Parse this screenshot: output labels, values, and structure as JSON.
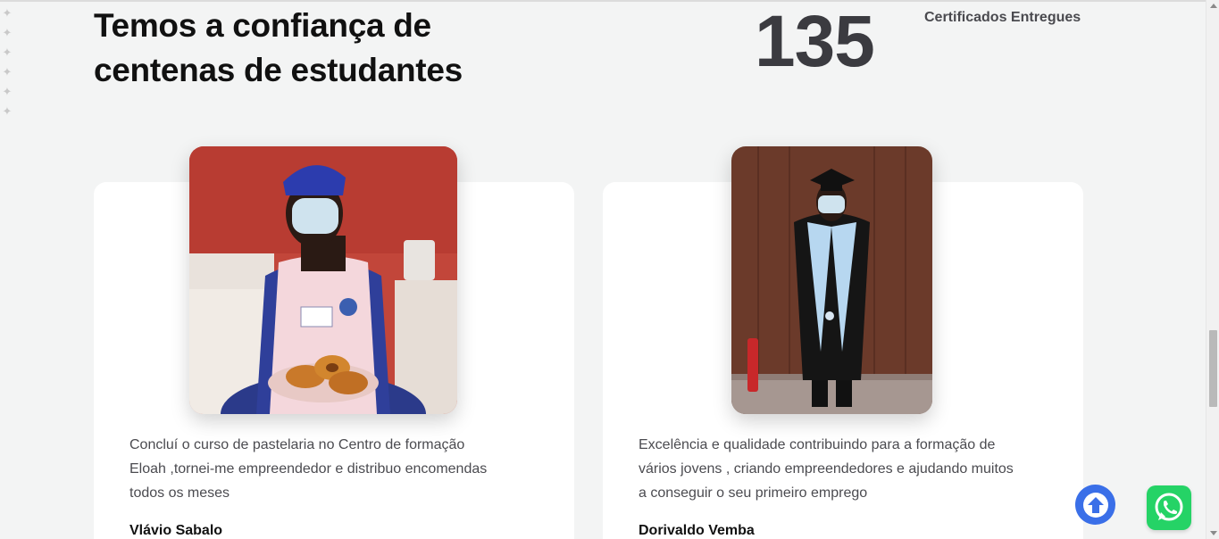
{
  "section": {
    "headline": "Temos a confiança de centenas de estudantes",
    "stat_number": "135",
    "stat_label": "Certificados Entregues"
  },
  "testimonials": [
    {
      "quote": "Concluí o curso de pastelaria no Centro de formação Eloah ,tornei-me empreendedor e distribuo encomendas todos os meses",
      "author": "Vlávio Sabalo"
    },
    {
      "quote": "Excelência e qualidade contribuindo para a formação de vários jovens , criando empreendedores e ajudando muitos a conseguir o seu primeiro emprego",
      "author": "Dorivaldo Vemba"
    }
  ],
  "icons": {
    "scroll_up": "arrow-up-circle-icon",
    "whatsapp": "whatsapp-icon"
  },
  "colors": {
    "scroll_up_bg": "#3a6fe8",
    "whatsapp_bg": "#25d366"
  }
}
